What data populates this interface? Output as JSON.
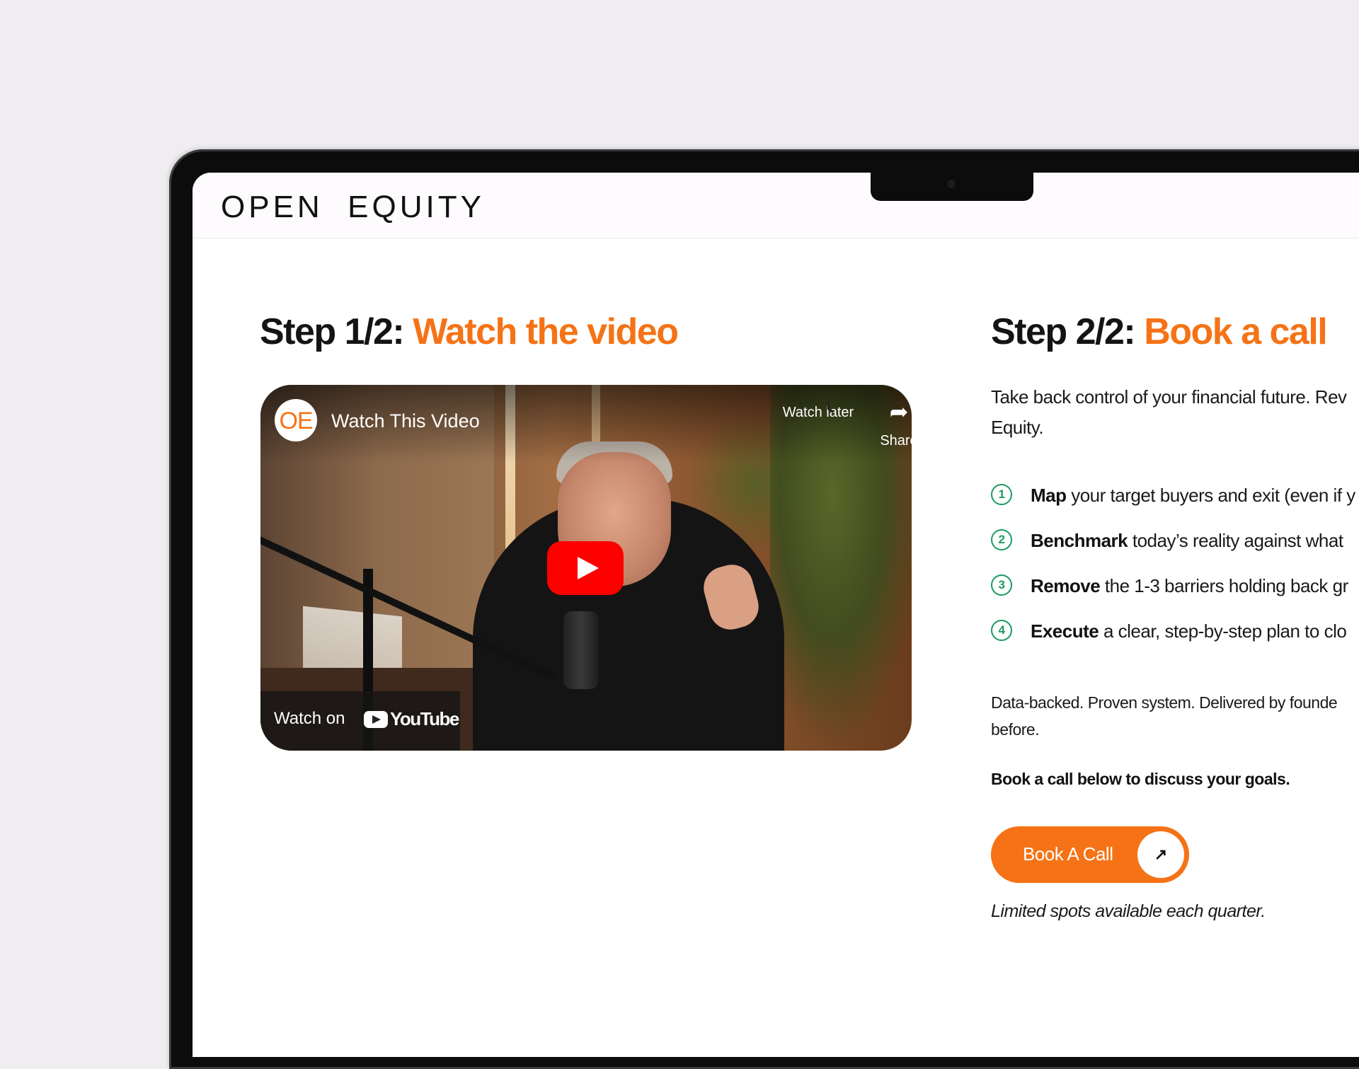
{
  "brand": {
    "name": "OPEN  EQUITY"
  },
  "step1": {
    "prefix": "Step 1/2:",
    "title": "Watch the video"
  },
  "video": {
    "channel_initials": "OE",
    "title": "Watch This Video",
    "watch_later_label": "Watch later",
    "share_label": "Share",
    "watch_on_label": "Watch on",
    "platform_label": "YouTube"
  },
  "step2": {
    "prefix": "Step 2/2:",
    "title": "Book a call",
    "intro": "Take back control of your financial future. Rev\nEquity.",
    "items": [
      {
        "num": "1",
        "bold": "Map",
        "text": " your target buyers and exit (even if y"
      },
      {
        "num": "2",
        "bold": "Benchmark",
        "text": " today’s reality against what"
      },
      {
        "num": "3",
        "bold": "Remove",
        "text": " the 1-3 barriers holding back gr"
      },
      {
        "num": "4",
        "bold": "Execute",
        "text": " a clear, step-by-step plan to clo"
      }
    ],
    "proof": "Data-backed. Proven system. Delivered by founde\nbefore.",
    "cta_line": "Book a call below to discuss your goals.",
    "button_label": "Book A Call",
    "button_arrow": "↗",
    "limited_note": "Limited spots available each quarter."
  },
  "colors": {
    "accent": "#f57316",
    "step_number": "#1b9a62",
    "text": "#141414",
    "page_bg": "#efedef"
  },
  "icons": [
    "clock-icon",
    "share-icon",
    "play-icon",
    "youtube-icon",
    "arrow-up-right-icon"
  ]
}
